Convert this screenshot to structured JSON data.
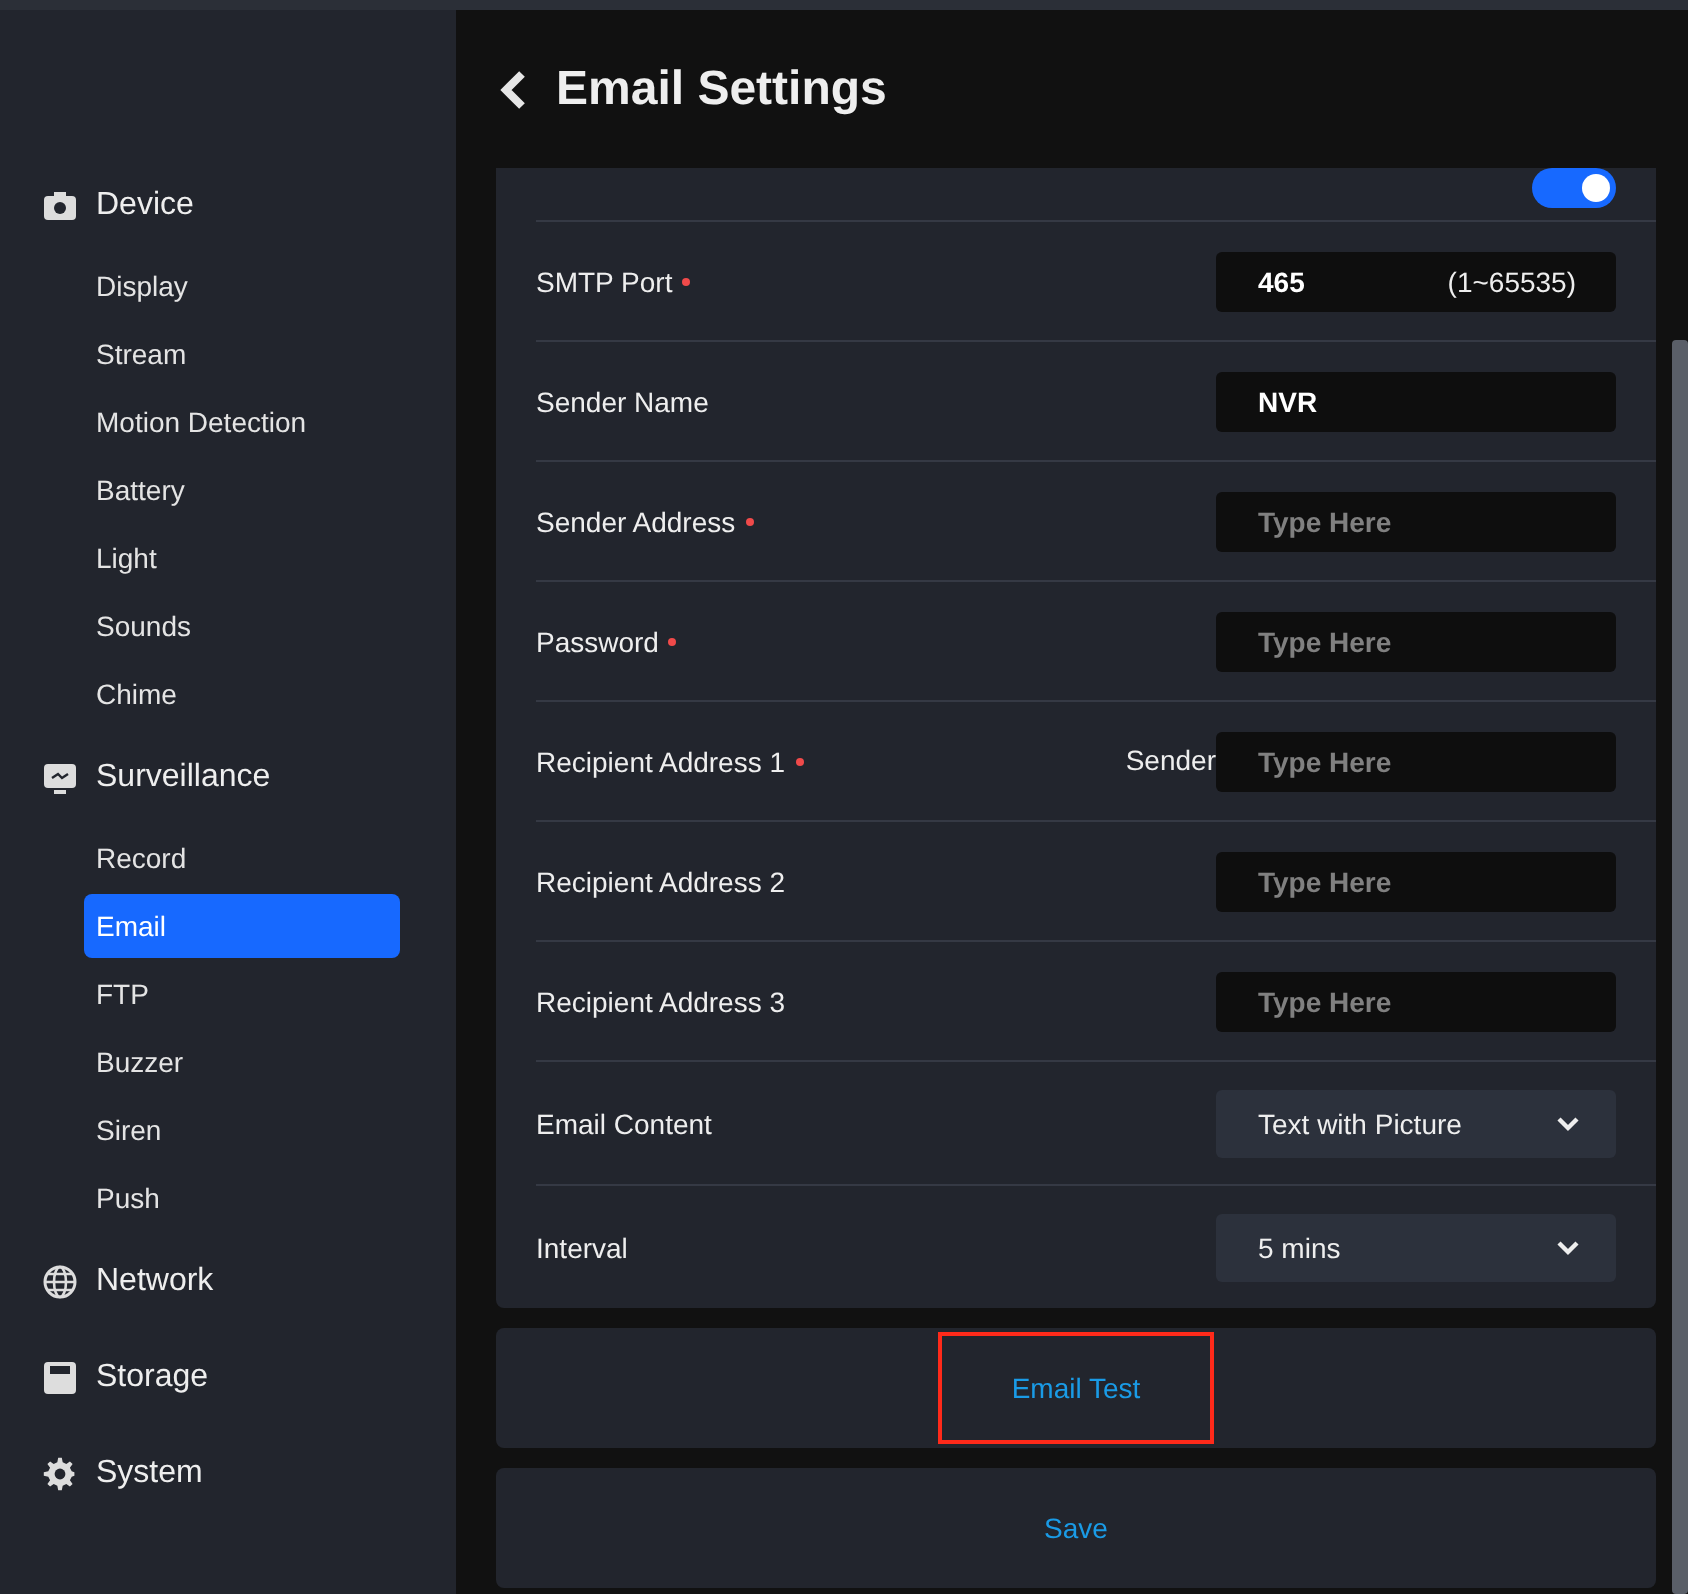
{
  "sidebar": {
    "groups": [
      {
        "label": "Device",
        "items": [
          {
            "label": "Display",
            "selected": false
          },
          {
            "label": "Stream",
            "selected": false
          },
          {
            "label": "Motion Detection",
            "selected": false
          },
          {
            "label": "Battery",
            "selected": false
          },
          {
            "label": "Light",
            "selected": false
          },
          {
            "label": "Sounds",
            "selected": false
          },
          {
            "label": "Chime",
            "selected": false
          }
        ]
      },
      {
        "label": "Surveillance",
        "items": [
          {
            "label": "Record",
            "selected": false
          },
          {
            "label": "Email",
            "selected": true
          },
          {
            "label": "FTP",
            "selected": false
          },
          {
            "label": "Buzzer",
            "selected": false
          },
          {
            "label": "Siren",
            "selected": false
          },
          {
            "label": "Push",
            "selected": false
          }
        ]
      },
      {
        "label": "Network"
      },
      {
        "label": "Storage"
      },
      {
        "label": "System"
      }
    ]
  },
  "header": {
    "title": "Email Settings"
  },
  "form": {
    "top_toggle": {
      "on": true
    },
    "rows": [
      {
        "kind": "input",
        "label": "SMTP Port",
        "required": true,
        "value": "465",
        "hint": "(1~65535)"
      },
      {
        "kind": "input",
        "label": "Sender Name",
        "required": false,
        "value": "NVR"
      },
      {
        "kind": "input",
        "label": "Sender Address",
        "required": true,
        "placeholder": "Type Here"
      },
      {
        "kind": "input",
        "label": "Password",
        "required": true,
        "placeholder": "Type Here"
      },
      {
        "kind": "input",
        "label": "Recipient Address 1",
        "required": true,
        "side_label": "Sender",
        "placeholder": "Type Here"
      },
      {
        "kind": "input",
        "label": "Recipient Address 2",
        "required": false,
        "placeholder": "Type Here"
      },
      {
        "kind": "input",
        "label": "Recipient Address 3",
        "required": false,
        "placeholder": "Type Here"
      },
      {
        "kind": "select",
        "label": "Email Content",
        "value": "Text with Picture"
      },
      {
        "kind": "select",
        "label": "Interval",
        "value": "5 mins"
      }
    ]
  },
  "actions": [
    {
      "label": "Email Test",
      "highlighted": true
    },
    {
      "label": "Save",
      "highlighted": false
    }
  ]
}
